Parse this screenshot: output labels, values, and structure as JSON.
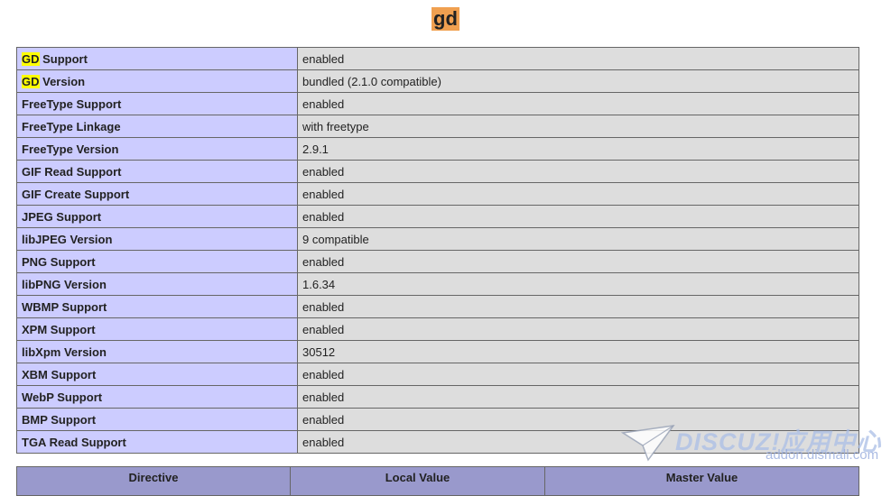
{
  "title": "gd",
  "rows": [
    {
      "key_hl": "GD",
      "key": " Support",
      "value": "enabled"
    },
    {
      "key_hl": "GD",
      "key": " Version",
      "value": "bundled (2.1.0 compatible)"
    },
    {
      "key_hl": "",
      "key": "FreeType Support",
      "value": "enabled"
    },
    {
      "key_hl": "",
      "key": "FreeType Linkage",
      "value": "with freetype"
    },
    {
      "key_hl": "",
      "key": "FreeType Version",
      "value": "2.9.1"
    },
    {
      "key_hl": "",
      "key": "GIF Read Support",
      "value": "enabled"
    },
    {
      "key_hl": "",
      "key": "GIF Create Support",
      "value": "enabled"
    },
    {
      "key_hl": "",
      "key": "JPEG Support",
      "value": "enabled"
    },
    {
      "key_hl": "",
      "key": "libJPEG Version",
      "value": "9 compatible"
    },
    {
      "key_hl": "",
      "key": "PNG Support",
      "value": "enabled"
    },
    {
      "key_hl": "",
      "key": "libPNG Version",
      "value": "1.6.34"
    },
    {
      "key_hl": "",
      "key": "WBMP Support",
      "value": "enabled"
    },
    {
      "key_hl": "",
      "key": "XPM Support",
      "value": "enabled"
    },
    {
      "key_hl": "",
      "key": "libXpm Version",
      "value": "30512"
    },
    {
      "key_hl": "",
      "key": "XBM Support",
      "value": "enabled"
    },
    {
      "key_hl": "",
      "key": "WebP Support",
      "value": "enabled"
    },
    {
      "key_hl": "",
      "key": "BMP Support",
      "value": "enabled"
    },
    {
      "key_hl": "",
      "key": "TGA Read Support",
      "value": "enabled"
    }
  ],
  "directive_headers": [
    "Directive",
    "Local Value",
    "Master Value"
  ],
  "watermark": {
    "brand": "DISCUZ!",
    "cn": "应用中心",
    "url": "addon.dismall.com"
  }
}
